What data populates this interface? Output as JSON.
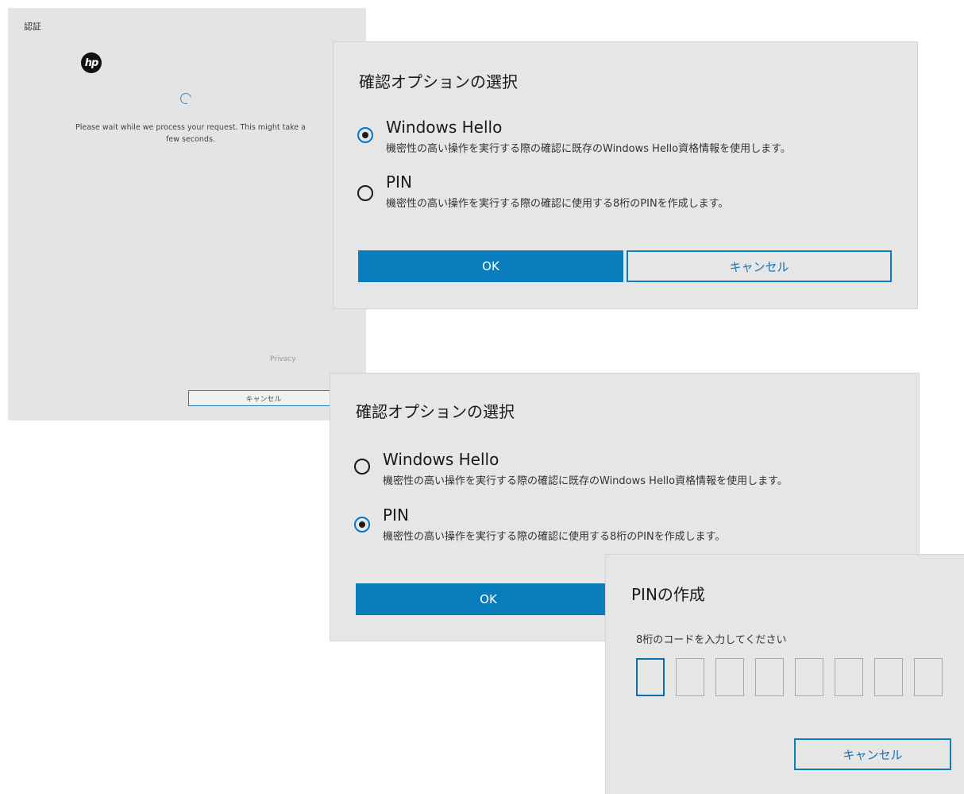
{
  "auth_window": {
    "title": "認証",
    "logo_text": "hp",
    "wait_message": "Please wait while we process your request. This might take a few seconds.",
    "privacy_link": "Privacy",
    "cancel_label": "キャンセル"
  },
  "dialog_1": {
    "heading": "確認オプションの選択",
    "options": [
      {
        "name": "Windows Hello",
        "description": "機密性の高い操作を実行する際の確認に既存のWindows Hello資格情報を使用します。",
        "selected": true
      },
      {
        "name": "PIN",
        "description": "機密性の高い操作を実行する際の確認に使用する8桁のPINを作成します。",
        "selected": false
      }
    ],
    "ok_label": "OK",
    "cancel_label": "キャンセル"
  },
  "dialog_2": {
    "heading": "確認オプションの選択",
    "options": [
      {
        "name": "Windows Hello",
        "description": "機密性の高い操作を実行する際の確認に既存のWindows Hello資格情報を使用します。",
        "selected": false
      },
      {
        "name": "PIN",
        "description": "機密性の高い操作を実行する際の確認に使用する8桁のPINを作成します。",
        "selected": true
      }
    ],
    "ok_label": "OK"
  },
  "pin_dialog": {
    "heading": "PINの作成",
    "prompt": "8桁のコードを入力してください",
    "digit_count": 8,
    "cancel_label": "キャンセル"
  },
  "colors": {
    "accent": "#0a7dbc",
    "panel_bg": "#e6e6e6"
  }
}
